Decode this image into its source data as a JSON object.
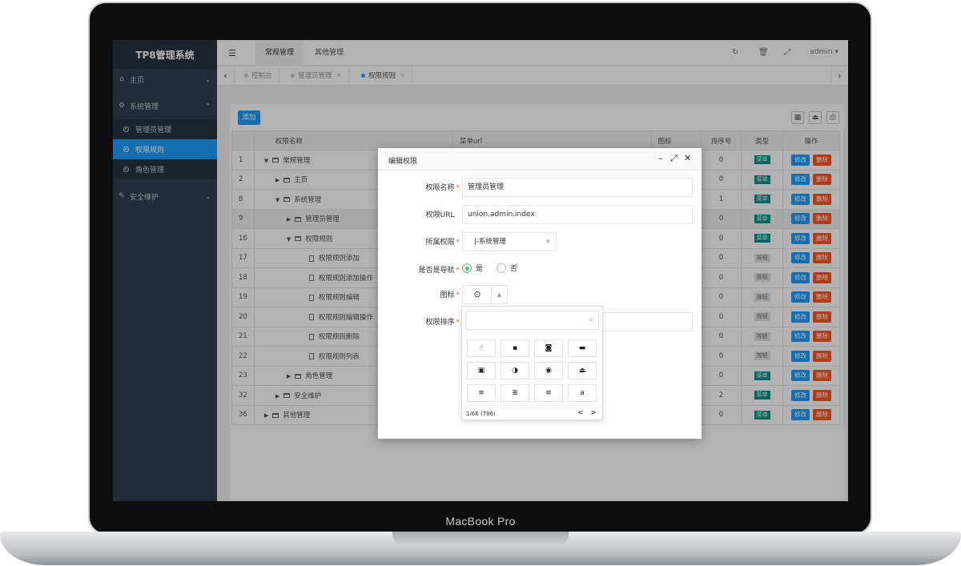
{
  "device": {
    "label": "MacBook Pro"
  },
  "sidebar": {
    "brand": "TP8管理系统",
    "home": "主页",
    "system": "系统管理",
    "sub_items": [
      "管理员管理",
      "权限规则",
      "角色管理"
    ],
    "security": "安全维护"
  },
  "header": {
    "menu_icon": "☰",
    "tabs": [
      "常规管理",
      "其他管理"
    ],
    "user": "admin ▾"
  },
  "page_tabs": {
    "tabs": [
      "控制台",
      "管理员管理",
      "权限规则"
    ],
    "close_glyph": "×"
  },
  "toolbar": {
    "add_label": "添加"
  },
  "table": {
    "headers": [
      "",
      "权限名称",
      "菜单url",
      "图标",
      "排序号",
      "类型",
      "操作"
    ],
    "rows": [
      {
        "id": "1",
        "name": "常规管理",
        "sort": "0",
        "type": "菜单"
      },
      {
        "id": "2",
        "name": "主页",
        "sort": "0",
        "type": "菜单"
      },
      {
        "id": "8",
        "name": "系统管理",
        "sort": "1",
        "type": "菜单"
      },
      {
        "id": "9",
        "name": "管理员管理",
        "sort": "0",
        "type": "菜单"
      },
      {
        "id": "16",
        "name": "权限规则",
        "sort": "0",
        "type": "菜单"
      },
      {
        "id": "17",
        "name": "权限规则添加",
        "sort": "0",
        "type": "按钮"
      },
      {
        "id": "18",
        "name": "权限规则添加操作",
        "sort": "0",
        "type": "按钮"
      },
      {
        "id": "19",
        "name": "权限规则编辑",
        "sort": "0",
        "type": "按钮"
      },
      {
        "id": "20",
        "name": "权限规则编辑操作",
        "sort": "0",
        "type": "按钮"
      },
      {
        "id": "21",
        "name": "权限规则删除",
        "sort": "0",
        "type": "按钮"
      },
      {
        "id": "22",
        "name": "权限规则列表",
        "sort": "0",
        "type": "按钮"
      },
      {
        "id": "23",
        "name": "角色管理",
        "sort": "0",
        "type": "菜单"
      },
      {
        "id": "32",
        "name": "安全维护",
        "sort": "2",
        "type": "菜单"
      },
      {
        "id": "36",
        "name": "其他管理",
        "sort": "0",
        "type": "菜单"
      }
    ],
    "edit_label": "修改",
    "delete_label": "删除"
  },
  "modal": {
    "title": "编辑权限",
    "labels": {
      "name": "权限名称",
      "url": "权限URL",
      "parent": "所属权限",
      "is_nav": "是否是导航",
      "icon": "图标",
      "sort": "权限排序"
    },
    "required_mark": "*",
    "values": {
      "name": "管理员管理",
      "url": "union.admin.index",
      "parent": "|-系统管理",
      "sort": ""
    },
    "radio_yes": "是",
    "radio_no": "否",
    "current_icon": "⊙"
  },
  "icon_picker": {
    "icons": [
      "☝",
      "▪",
      "◙",
      "▬",
      "▣",
      "◑",
      "◉",
      "⏏",
      "≡",
      "≣",
      "≡",
      "a"
    ],
    "page_info": "1/66 (786)",
    "nav": "< >"
  },
  "colors": {
    "sidebar_bg": "#2f4050",
    "active_blue": "#1e9fff",
    "menu_green": "#009688",
    "delete_orange": "#ff5722"
  }
}
